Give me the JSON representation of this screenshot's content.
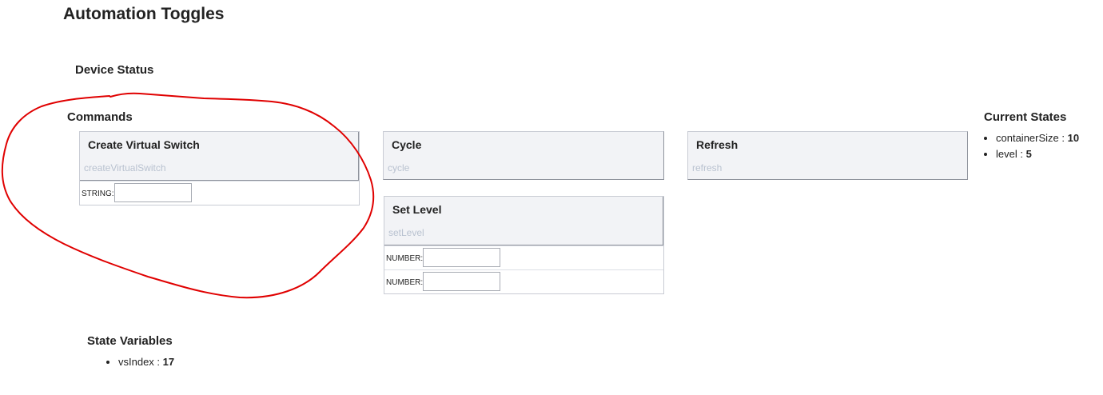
{
  "page": {
    "title": "Automation Toggles"
  },
  "sections": {
    "device_status": "Device Status",
    "commands": "Commands",
    "current_states": "Current States",
    "state_variables": "State Variables"
  },
  "commands": [
    {
      "name": "Create Virtual Switch",
      "method": "createVirtualSwitch",
      "params": [
        {
          "type": "STRING:",
          "value": ""
        }
      ]
    },
    {
      "name": "Cycle",
      "method": "cycle",
      "params": []
    },
    {
      "name": "Refresh",
      "method": "refresh",
      "params": []
    },
    {
      "name": "Set Level",
      "method": "setLevel",
      "params": [
        {
          "type": "NUMBER:",
          "value": ""
        },
        {
          "type": "NUMBER:",
          "value": ""
        }
      ]
    }
  ],
  "current_states": [
    {
      "name": "containerSize",
      "sep": " : ",
      "value": "10"
    },
    {
      "name": "level",
      "sep": " : ",
      "value": "5"
    }
  ],
  "state_variables": [
    {
      "name": "vsIndex",
      "sep": " : ",
      "value": "17"
    }
  ],
  "annotation": {
    "color": "#e00000",
    "shape": "freehand-circle"
  }
}
